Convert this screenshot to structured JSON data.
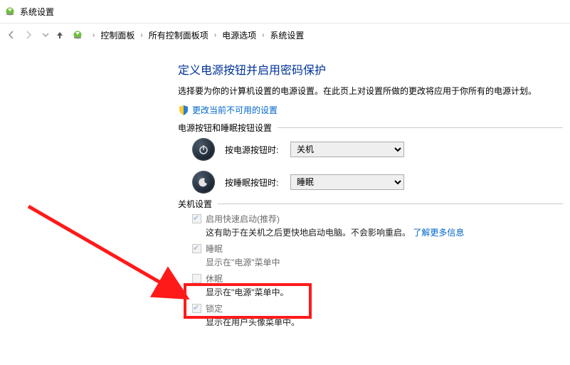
{
  "window": {
    "title": "系统设置"
  },
  "breadcrumb": {
    "items": [
      "控制面板",
      "所有控制面板项",
      "电源选项",
      "系统设置"
    ]
  },
  "main": {
    "heading": "定义电源按钮并启用密码保护",
    "description": "选择要为你的计算机设置的电源设置。在此页上对设置所做的更改将应用于你所有的电源计划。",
    "change_link": "更改当前不可用的设置",
    "button_section": {
      "legend": "电源按钮和睡眠按钮设置",
      "power_button": {
        "label": "按电源按钮时:",
        "value": "关机"
      },
      "sleep_button": {
        "label": "按睡眠按钮时:",
        "value": "睡眠"
      }
    },
    "shutdown_section": {
      "legend": "关机设置",
      "fast_startup": {
        "label": "启用快速启动(推荐)",
        "sub_prefix": "这有助于在关机之后更快地启动电脑。不会影响重启。",
        "learn_more": "了解更多信息"
      },
      "sleep": {
        "label": "睡眠",
        "sub": "显示在\"电源\"菜单中"
      },
      "hibernate": {
        "label": "休眠",
        "sub": "显示在\"电源\"菜单中。"
      },
      "lock": {
        "label": "锁定",
        "sub": "显示在用户头像菜单中。"
      }
    }
  }
}
